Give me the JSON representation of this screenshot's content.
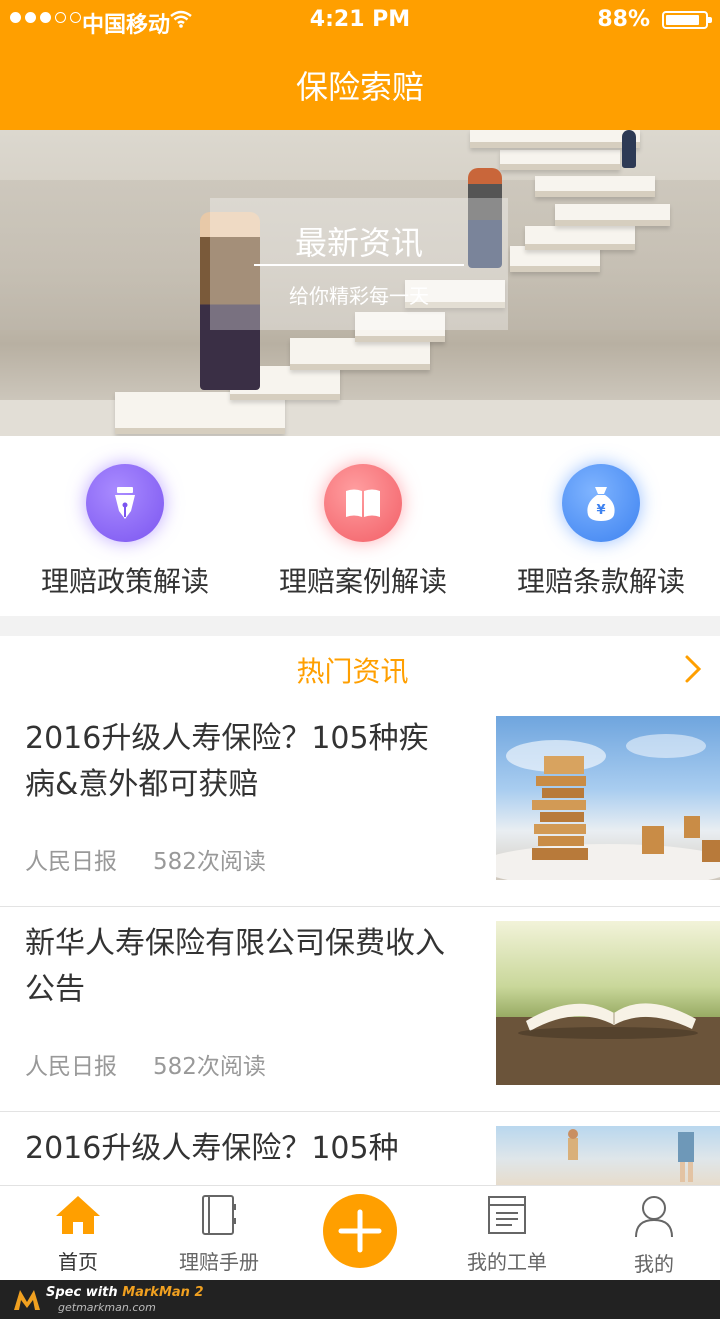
{
  "status_bar": {
    "carrier": "中国移动",
    "time": "4:21 PM",
    "battery": "88%",
    "battery_level": 0.88,
    "signal_bars": 3,
    "signal_total": 5
  },
  "header": {
    "title": "保险索赔"
  },
  "banner": {
    "title": "最新资讯",
    "subtitle": "给你精彩每一天"
  },
  "quick_entries": [
    {
      "label": "理赔政策解读",
      "icon": "pen-nib-icon",
      "color": "#7b55f0"
    },
    {
      "label": "理赔案例解读",
      "icon": "book-icon",
      "color": "#f25e66"
    },
    {
      "label": "理赔条款解读",
      "icon": "money-bag-icon",
      "color": "#3d82f0"
    }
  ],
  "hot_news": {
    "title": "热门资讯",
    "items": [
      {
        "title": "2016升级人寿保险？105种疾病&意外都可获赔",
        "source": "人民日报",
        "reads": "582次阅读"
      },
      {
        "title": "新华人寿保险有限公司保费收入公告",
        "source": "人民日报",
        "reads": "582次阅读"
      },
      {
        "title": "2016升级人寿保险？105种",
        "source": "",
        "reads": ""
      }
    ]
  },
  "tabbar": {
    "items": [
      {
        "label": "首页",
        "icon": "home-icon"
      },
      {
        "label": "理赔手册",
        "icon": "handbook-icon"
      },
      {
        "label": "",
        "icon": "plus-icon"
      },
      {
        "label": "我的工单",
        "icon": "work-order-icon"
      },
      {
        "label": "我的",
        "icon": "user-icon"
      }
    ]
  },
  "markman": {
    "spec": "Spec with ",
    "brand": "MarkMan 2",
    "url": "getmarkman.com"
  },
  "colors": {
    "accent": "#ff9f00",
    "text": "#333333",
    "muted": "#999999"
  }
}
